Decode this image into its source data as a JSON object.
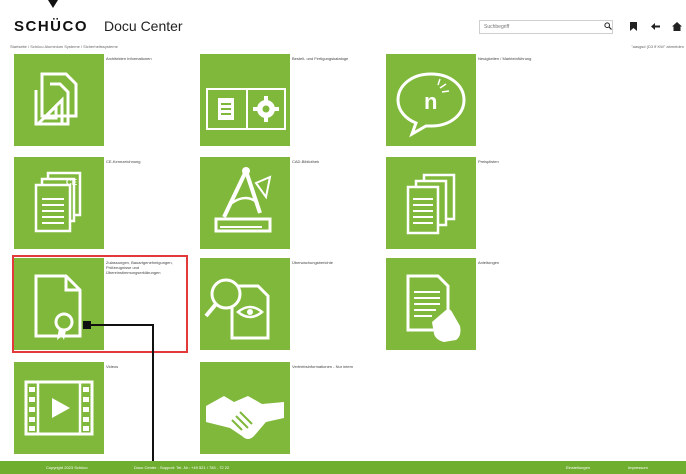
{
  "header": {
    "logo": "SCHÜCO",
    "app_title": "Docu Center",
    "search_placeholder": "Suchbegriff",
    "icons": [
      "search-icon",
      "bookmark-icon",
      "back-icon",
      "home-icon"
    ]
  },
  "breadcrumb": "Startseite / Schüco Aluminium Systeme / Sicherheitssysteme",
  "results": "\"aasgsd (D3 ff KW\" abmelden",
  "tiles": [
    {
      "label": "Architekten Informationen",
      "icon": "document-triangle-icon"
    },
    {
      "label": "Bestell- und Fertigungskataloge",
      "icon": "catalog-gear-icon"
    },
    {
      "label": "Neuigkeiten / Markteinführung",
      "icon": "speech-bubble-icon"
    },
    {
      "label": "CE-Kennzeichnung",
      "icon": "ce-document-icon"
    },
    {
      "label": "CAD-Bibliothek",
      "icon": "drafting-compass-icon"
    },
    {
      "label": "Preisplisten",
      "icon": "price-list-icon"
    },
    {
      "label": "Zulassungen, Bauartgenehmigungen, Prüfzeugnisse und Übereinstimmungserklärungen",
      "icon": "certificate-icon"
    },
    {
      "label": "Überwachungsberichte",
      "icon": "inspection-icon"
    },
    {
      "label": "Anleitungen",
      "icon": "instructions-hand-icon"
    },
    {
      "label": "Videos",
      "icon": "film-icon"
    },
    {
      "label": "Vertriebsinformationen - Nur intern",
      "icon": "handshake-icon"
    }
  ],
  "footer": {
    "copyright": "Copyright 2023 Schüco",
    "support": "Docu Center - Support: Tel.-Nr.: +49 521 / 783 - 72 22",
    "settings": "Einstellungen",
    "imprint": "Impressum"
  },
  "colors": {
    "tile_green": "#7fb83a",
    "footer_green": "#6fae2f",
    "highlight_red": "#e23a3a"
  }
}
